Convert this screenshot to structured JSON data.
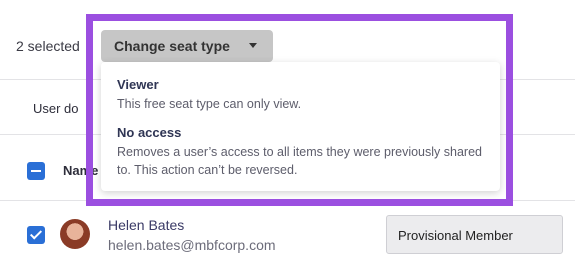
{
  "toolbar": {
    "selected_count": "2 selected",
    "change_seat_type_label": "Change seat type"
  },
  "table": {
    "column_header": "User do",
    "name_header": "Name"
  },
  "dropdown": {
    "options": [
      {
        "title": "Viewer",
        "description": "This free seat type can only view."
      },
      {
        "title": "No access",
        "description": "Removes a user’s access to all items they were previously shared to. This action can’t be reversed."
      }
    ]
  },
  "user_row": {
    "name": "Helen Bates",
    "email": "helen.bates@mbfcorp.com",
    "role": "Provisional Member"
  },
  "colors": {
    "accent": "#2a6fd6",
    "highlight": "#9b4fe0"
  }
}
